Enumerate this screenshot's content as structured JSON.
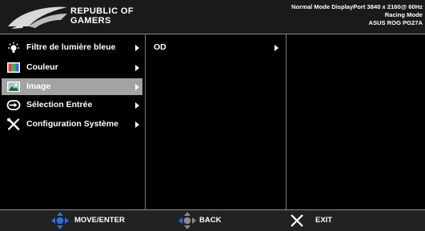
{
  "header": {
    "brand_line1": "REPUBLIC OF",
    "brand_line2": "GAMERS",
    "status_line1": "Normal Mode DisplayPort 3840 x 2160@ 60Hz",
    "status_line2": "Racing Mode",
    "status_line3": "ASUS ROG PG27A"
  },
  "menu": {
    "items": [
      {
        "label": "Filtre de lumière bleue",
        "icon": "bulb-icon"
      },
      {
        "label": "Couleur",
        "icon": "color-icon"
      },
      {
        "label": "Image",
        "icon": "image-icon",
        "selected": true
      },
      {
        "label": "Sélection Entrée",
        "icon": "input-icon"
      },
      {
        "label": "Configuration Système",
        "icon": "wrench-screwdriver-icon"
      }
    ]
  },
  "submenu": {
    "items": [
      {
        "label": "OD"
      }
    ]
  },
  "footer": {
    "move_label": "MOVE/ENTER",
    "back_label": "BACK",
    "exit_label": "EXIT"
  },
  "colors": {
    "selected_bg": "#a3a3a3",
    "joystick_blue": "#2e6fe0",
    "divider": "#7a7a7a"
  }
}
